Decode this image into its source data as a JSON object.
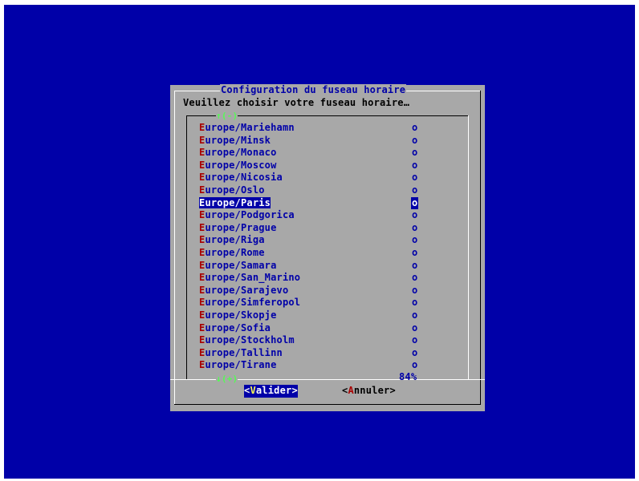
{
  "dialog": {
    "title": "Configuration du fuseau horaire",
    "prompt": "Veuillez choisir votre fuseau horaire…"
  },
  "list": {
    "scroll_up_indicator": "↑(-)",
    "scroll_down_indicator": "↓(+)",
    "scroll_percent": "84%",
    "items": [
      {
        "hotkey": "E",
        "rest": "urope/Mariehamn",
        "mark": "o",
        "selected": false
      },
      {
        "hotkey": "E",
        "rest": "urope/Minsk",
        "mark": "o",
        "selected": false
      },
      {
        "hotkey": "E",
        "rest": "urope/Monaco",
        "mark": "o",
        "selected": false
      },
      {
        "hotkey": "E",
        "rest": "urope/Moscow",
        "mark": "o",
        "selected": false
      },
      {
        "hotkey": "E",
        "rest": "urope/Nicosia",
        "mark": "o",
        "selected": false
      },
      {
        "hotkey": "E",
        "rest": "urope/Oslo",
        "mark": "o",
        "selected": false
      },
      {
        "hotkey": "E",
        "rest": "urope/Paris",
        "mark": "o",
        "selected": true
      },
      {
        "hotkey": "E",
        "rest": "urope/Podgorica",
        "mark": "o",
        "selected": false
      },
      {
        "hotkey": "E",
        "rest": "urope/Prague",
        "mark": "o",
        "selected": false
      },
      {
        "hotkey": "E",
        "rest": "urope/Riga",
        "mark": "o",
        "selected": false
      },
      {
        "hotkey": "E",
        "rest": "urope/Rome",
        "mark": "o",
        "selected": false
      },
      {
        "hotkey": "E",
        "rest": "urope/Samara",
        "mark": "o",
        "selected": false
      },
      {
        "hotkey": "E",
        "rest": "urope/San_Marino",
        "mark": "o",
        "selected": false
      },
      {
        "hotkey": "E",
        "rest": "urope/Sarajevo",
        "mark": "o",
        "selected": false
      },
      {
        "hotkey": "E",
        "rest": "urope/Simferopol",
        "mark": "o",
        "selected": false
      },
      {
        "hotkey": "E",
        "rest": "urope/Skopje",
        "mark": "o",
        "selected": false
      },
      {
        "hotkey": "E",
        "rest": "urope/Sofia",
        "mark": "o",
        "selected": false
      },
      {
        "hotkey": "E",
        "rest": "urope/Stockholm",
        "mark": "o",
        "selected": false
      },
      {
        "hotkey": "E",
        "rest": "urope/Tallinn",
        "mark": "o",
        "selected": false
      },
      {
        "hotkey": "E",
        "rest": "urope/Tirane",
        "mark": "o",
        "selected": false
      }
    ]
  },
  "buttons": {
    "ok": {
      "open": "<",
      "hotkey": "V",
      "rest": "alider",
      "close": ">"
    },
    "cancel": {
      "open": "<",
      "hotkey": "A",
      "rest": "nnuler",
      "close": ">"
    }
  },
  "colors": {
    "background": "#0000a8",
    "dialog": "#a8a8a8",
    "hotkey": "#a80000",
    "text": "#0000a8",
    "arrow": "#54fc54"
  }
}
